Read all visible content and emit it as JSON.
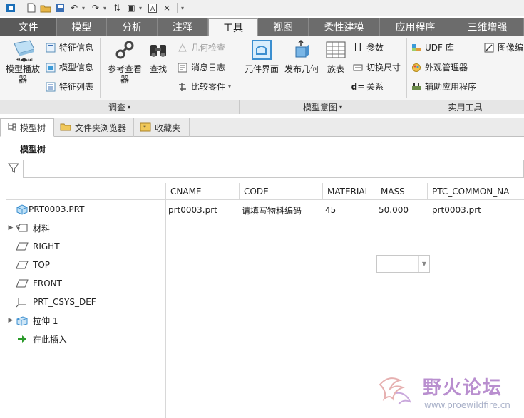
{
  "ribbon_tabs": [
    {
      "label": "文件",
      "state": "file"
    },
    {
      "label": "模型",
      "state": "normal"
    },
    {
      "label": "分析",
      "state": "normal"
    },
    {
      "label": "注释",
      "state": "normal"
    },
    {
      "label": "工具",
      "state": "active"
    },
    {
      "label": "视图",
      "state": "normal"
    },
    {
      "label": "柔性建模",
      "state": "normal"
    },
    {
      "label": "应用程序",
      "state": "normal"
    },
    {
      "label": "三维增强",
      "state": "normal"
    }
  ],
  "ribbon": {
    "investigate": {
      "model_player": "模型播放\n器",
      "feature_info": "特征信息",
      "model_info": "模型信息",
      "feature_list": "特征列表",
      "reference_viewer": "参考查看\n器",
      "find": "查找",
      "geometry_check": "几何检查",
      "message_log": "消息日志",
      "compare_part": "比较零件",
      "group_label": "调查"
    },
    "model_intent": {
      "component_interface": "元件界面",
      "publish_geometry": "发布几何",
      "family_table": "族表",
      "parameters": "参数",
      "switch_dimensions": "切换尺寸",
      "relations": "关系",
      "group_label": "模型意图"
    },
    "utilities": {
      "udf_library": "UDF 库",
      "image_editor": "图像编",
      "appearance_manager": "外观管理器",
      "auxiliary_apps": "辅助应用程序",
      "group_label": "实用工具"
    }
  },
  "navigator": {
    "tabs": [
      "模型树",
      "文件夹浏览器",
      "收藏夹"
    ],
    "title": "模型树",
    "filter_value": ""
  },
  "tree_table": {
    "columns": [
      "CNAME",
      "CODE",
      "MATERIAL",
      "MASS",
      "PTC_COMMON_NA"
    ],
    "items": [
      {
        "label": "PRT0003.PRT",
        "icon": "part-icon",
        "expandable": false
      },
      {
        "label": "材料",
        "icon": "material-icon",
        "expandable": true
      },
      {
        "label": "RIGHT",
        "icon": "datum-plane-icon",
        "expandable": false
      },
      {
        "label": "TOP",
        "icon": "datum-plane-icon",
        "expandable": false
      },
      {
        "label": "FRONT",
        "icon": "datum-plane-icon",
        "expandable": false
      },
      {
        "label": "PRT_CSYS_DEF",
        "icon": "csys-icon",
        "expandable": false
      },
      {
        "label": "拉伸 1",
        "icon": "extrude-icon",
        "expandable": true
      },
      {
        "label": "在此插入",
        "icon": "insert-here-icon",
        "expandable": false
      }
    ],
    "root_row": {
      "cname": "prt0003.prt",
      "code": "请填写物料编码",
      "material": "45",
      "mass": "50.000",
      "ptc_common_name": "prt0003.prt"
    }
  },
  "watermark": {
    "text": "野火论坛",
    "url": "www.proewildfire.cn"
  }
}
